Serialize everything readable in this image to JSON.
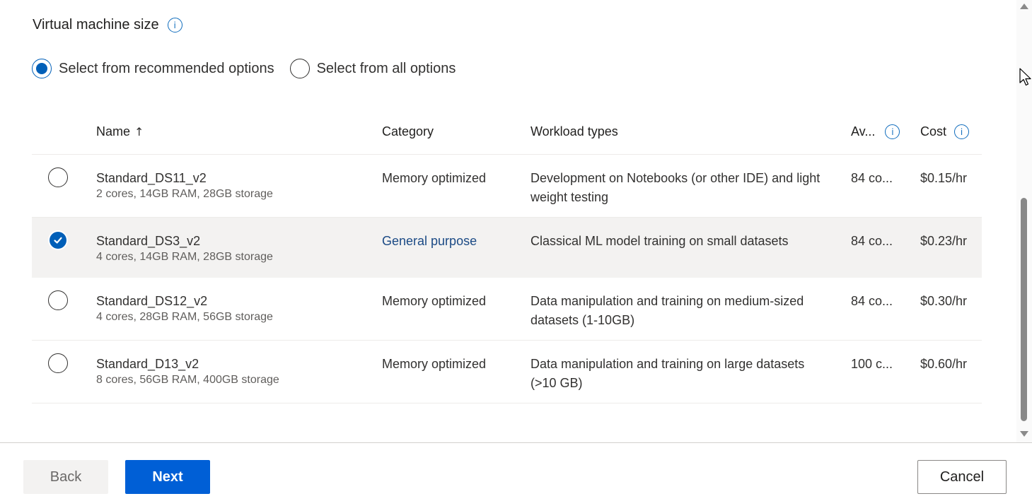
{
  "section": {
    "title": "Virtual machine size",
    "info_icon": "info-icon"
  },
  "selection_mode": {
    "options": [
      {
        "label": "Select from recommended options",
        "checked": true
      },
      {
        "label": "Select from all options",
        "checked": false
      }
    ]
  },
  "table": {
    "columns": {
      "name": "Name",
      "name_sort": "↑",
      "category": "Category",
      "workload": "Workload types",
      "availability": "Av...",
      "cost": "Cost"
    },
    "rows": [
      {
        "selected": false,
        "name": "Standard_DS11_v2",
        "specs": "2 cores, 14GB RAM, 28GB storage",
        "category": "Memory optimized",
        "workload": "Development on Notebooks (or other IDE) and light weight testing",
        "availability": "84 co...",
        "cost": "$0.15/hr"
      },
      {
        "selected": true,
        "name": "Standard_DS3_v2",
        "specs": "4 cores, 14GB RAM, 28GB storage",
        "category": "General purpose",
        "workload": "Classical ML model training on small datasets",
        "availability": "84 co...",
        "cost": "$0.23/hr"
      },
      {
        "selected": false,
        "name": "Standard_DS12_v2",
        "specs": "4 cores, 28GB RAM, 56GB storage",
        "category": "Memory optimized",
        "workload": "Data manipulation and training on medium-sized datasets (1-10GB)",
        "availability": "84 co...",
        "cost": "$0.30/hr"
      },
      {
        "selected": false,
        "name": "Standard_D13_v2",
        "specs": "8 cores, 56GB RAM, 400GB storage",
        "category": "Memory optimized",
        "workload": "Data manipulation and training on large datasets (>10 GB)",
        "availability": "100 c...",
        "cost": "$0.60/hr"
      }
    ]
  },
  "footer": {
    "back_label": "Back",
    "next_label": "Next",
    "cancel_label": "Cancel"
  },
  "colors": {
    "accent": "#005fb8",
    "link": "#0f6cbd",
    "primary_button": "#005fd6",
    "selected_row": "#f3f2f1"
  }
}
